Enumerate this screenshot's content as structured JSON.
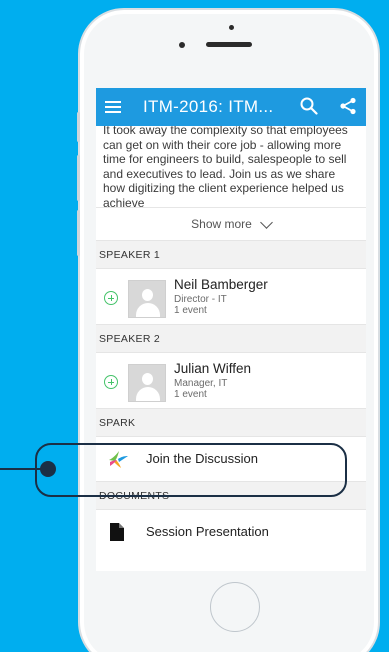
{
  "app_bar": {
    "title": "ITM-2016: ITM...",
    "background": "#1e9ae0"
  },
  "description": {
    "text": "It took away the complexity so that employees can get on with their core job - allowing more time for engineers to build, salespeople to sell and executives to lead. Join us as we share how digitizing the client experience helped us achieve",
    "show_more_label": "Show more"
  },
  "speakers": [
    {
      "section": "SPEAKER 1",
      "name": "Neil Bamberger",
      "title": "Director - IT",
      "events": "1 event"
    },
    {
      "section": "SPEAKER 2",
      "name": "Julian Wiffen",
      "title": "Manager, IT",
      "events": "1 event"
    }
  ],
  "spark": {
    "section": "SPARK",
    "label": "Join the Discussion"
  },
  "documents": {
    "section": "DOCUMENTS",
    "label": "Session Presentation"
  },
  "icons": {
    "menu": "hamburger-menu-icon",
    "search": "search-icon",
    "share": "share-icon",
    "add": "add-circle-icon",
    "avatar": "person-placeholder-icon",
    "spark": "spark-logo-icon",
    "document": "document-icon",
    "chevron": "chevron-down-icon"
  },
  "colors": {
    "background": "#00AEEF",
    "accent_green": "#45c36a",
    "callout": "#1b2f45"
  }
}
